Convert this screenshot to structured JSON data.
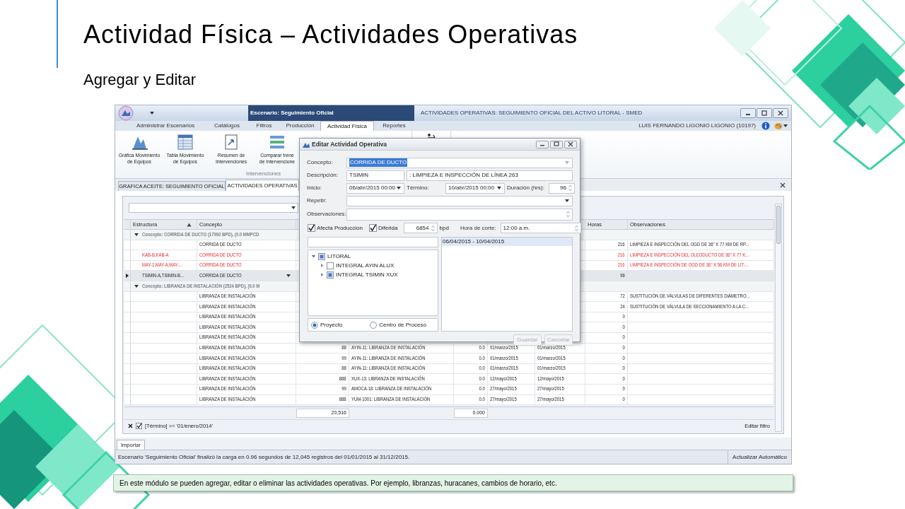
{
  "slide": {
    "title": "Actividad Física – Actividades Operativas",
    "subtitle": "Agregar y Editar",
    "caption": "En este módulo se pueden agregar, editar o eliminar las actividades operativas. Por ejemplo, libranzas, huracanes, cambios de horario, etc."
  },
  "app": {
    "scenario": "Escenario: Seguimiento Oficial",
    "window_title": "ACTIVIDADES OPERATIVAS: SEGUIMIENTO OFICIAL  DEL ACTIVO LITORAL - SMED",
    "ribbon_tabs": [
      {
        "label": "Administrar Escenarios",
        "selected": false
      },
      {
        "label": "Catálogos",
        "selected": false
      },
      {
        "label": "Filtros",
        "selected": false
      },
      {
        "label": "Producción",
        "selected": false
      },
      {
        "label": "Actividad Física",
        "selected": true
      },
      {
        "label": "Reportes",
        "selected": false
      }
    ],
    "user": "LUIS FERNANDO LIGONIO LIGONIO (10197)",
    "ribbon_buttons": [
      {
        "kind": "chart",
        "lines": [
          "Gráfica Movimiento",
          "de Equipos"
        ]
      },
      {
        "kind": "table",
        "lines": [
          "Tabla Movimiento",
          "de Equipos"
        ]
      },
      {
        "kind": "summary",
        "lines": [
          "Resumen de",
          "Intervenciones"
        ]
      },
      {
        "kind": "compare",
        "lines": [
          "Comparar trene",
          "de Intervencione"
        ]
      }
    ],
    "ribbon_group": "Intervenciones",
    "doc_tabs": [
      {
        "label": "GRAFICA ACEITE: SEGUIMIENTO OFICIAL",
        "selected": false
      },
      {
        "label": "ACTIVIDADES OPERATIVAS",
        "selected": true
      }
    ],
    "grid": {
      "columns": [
        {
          "label": "Estructura",
          "sorted": true
        },
        {
          "label": "Concepto",
          "sorted": false
        },
        {
          "label": "Horas",
          "sorted": false
        },
        {
          "label": "Observaciones",
          "sorted": false
        }
      ],
      "rows": [
        {
          "kind": "group",
          "expanded": true,
          "text": "Concepto: CORRIDA  DE DUCTO (17992 BPD), (0.0 MMPCD"
        },
        {
          "kind": "data",
          "selected": false,
          "flagged": false,
          "cells": {
            "concepto": "CORRIDA  DE DUCTO",
            "horas": "216",
            "observaciones": "LIMPIEZA E INSPECCIÓN DEL OGD DE 36\" X 77 KM DE RP..."
          }
        },
        {
          "kind": "data",
          "selected": false,
          "flagged": true,
          "cells": {
            "estructura": "KAB-B,KAB-A",
            "concepto": "CORRIDA  DE DUCTO",
            "horas": "216",
            "observaciones": "LIMPIEZA E INSPECCIÓN DEL OLEODUCTO DE 36\" X 77 K..."
          }
        },
        {
          "kind": "data",
          "selected": false,
          "flagged": true,
          "cells": {
            "estructura": "MAY-1,MAY-A,MAY-...",
            "concepto": "CORRIDA  DE DUCTO",
            "horas": "216",
            "observaciones": "LIMPIEZA E INSPECCIÓN DE OGD DE 36\" X 56 KM DE LIT-..."
          }
        },
        {
          "kind": "data",
          "selected": true,
          "flagged": false,
          "cells": {
            "estructura": "TSIMIN-A,TSIMIN-B...",
            "concepto": "CORRIDA  DE DUCTO",
            "horas": "96"
          }
        },
        {
          "kind": "group",
          "expanded": true,
          "text": "Concepto: LIBRANZA DE INSTALACIÓN (2524 BPD), (0.0 M"
        },
        {
          "kind": "data",
          "selected": false,
          "flagged": false,
          "cells": {
            "concepto": "LIBRANZA DE INSTALACIÓN",
            "horas": "72",
            "observaciones": "SUSTITUCIÓN DE VÁLVULAS DE DIFERENTES DIÁMETRO..."
          }
        },
        {
          "kind": "data",
          "selected": false,
          "flagged": false,
          "cells": {
            "concepto": "LIBRANZA DE INSTALACIÓN",
            "horas": "24",
            "observaciones": "SUSTITUCIÓN DE VÁLVULA DE SECCIONAMIENTO A LA C..."
          }
        },
        {
          "kind": "data",
          "selected": false,
          "flagged": false,
          "cells": {
            "concepto": "LIBRANZA DE INSTALACIÓN",
            "horas": "0"
          }
        },
        {
          "kind": "data",
          "selected": false,
          "flagged": false,
          "cells": {
            "concepto": "LIBRANZA DE INSTALACIÓN",
            "horas": "0"
          }
        },
        {
          "kind": "data",
          "selected": false,
          "flagged": false,
          "cells": {
            "concepto": "LIBRANZA DE INSTALACIÓN",
            "horas": "0"
          }
        },
        {
          "kind": "data",
          "selected": false,
          "flagged": false,
          "cells": {
            "concepto": "LIBRANZA DE INSTALACIÓN",
            "column_3": "88",
            "column_4": "AYIN-11: LIBRANZA DE INSTALACIÓN",
            "column_5": "0.0",
            "column_6": "01/marzo/2015",
            "column_7": "01/marzo/2015",
            "horas": "0"
          }
        },
        {
          "kind": "data",
          "selected": false,
          "flagged": false,
          "cells": {
            "concepto": "LIBRANZA DE INSTALACIÓN",
            "column_3": "99",
            "column_4": "AYIN-11: LIBRANZA DE INSTALACIÓN",
            "column_5": "0.0",
            "column_6": "01/marzo/2015",
            "column_7": "01/marzo/2015",
            "horas": "0"
          }
        },
        {
          "kind": "data",
          "selected": false,
          "flagged": false,
          "cells": {
            "concepto": "LIBRANZA DE INSTALACIÓN",
            "column_3": "88",
            "column_4": "AYIN-11: LIBRANZA DE INSTALACIÓN",
            "column_5": "0.0",
            "column_6": "01/marzo/2015",
            "column_7": "01/marzo/2015",
            "horas": "0"
          }
        },
        {
          "kind": "data",
          "selected": false,
          "flagged": false,
          "cells": {
            "concepto": "LIBRANZA DE INSTALACIÓN",
            "column_3": "888",
            "column_4": "XUX-13: LIBRANZA DE INSTALACIÓN",
            "column_5": "0.0",
            "column_6": "12/mayo/2015",
            "column_7": "12/mayo/2015",
            "horas": "0"
          }
        },
        {
          "kind": "data",
          "selected": false,
          "flagged": false,
          "cells": {
            "concepto": "LIBRANZA DE INSTALACIÓN",
            "column_3": "99",
            "column_4": "AMOCA-18: LIBRANZA DE INSTALACIÓN",
            "column_5": "0.0",
            "column_6": "27/mayo/2015",
            "column_7": "27/mayo/2015",
            "horas": "0"
          }
        },
        {
          "kind": "data",
          "selected": false,
          "flagged": false,
          "cells": {
            "concepto": "LIBRANZA DE INSTALACIÓN",
            "column_3": "888",
            "column_4": "YUM-1001: LIBRANZA DE INSTALACIÓN",
            "column_5": "0.0",
            "column_6": "27/mayo/2015",
            "column_7": "27/mayo/2015",
            "horas": "0"
          }
        }
      ],
      "totals": {
        "column_3": "20,516",
        "column_5": "0.000"
      },
      "filter": {
        "enabled": true,
        "text": "[Término] >= '01/enero/2014'",
        "edit": "Editar filtro"
      }
    },
    "bottom_tab": "Importar",
    "status": "Escenario 'Seguimiento Oficial' finalizó la carga en 0.96 segundos de 12,045 registros del 01/01/2015 al 31/12/2015.",
    "status_right": "Actualizar Automático"
  },
  "dialog": {
    "title": "Editar Actividad Operativa",
    "concepto": {
      "label": "Concepto:",
      "value": "CORRIDA  DE DUCTO"
    },
    "descripcion": {
      "label": "Descripción:",
      "code": "TSIMIN",
      "value": ": LIMPIEZA E INSPECCIÓN DE LÍNEA 263"
    },
    "inicio": {
      "label": "Inicio:",
      "value": "06/abr/2015 00:00"
    },
    "termino": {
      "label": "Término:",
      "value": "10/abr/2015 00:00"
    },
    "duracion": {
      "label": "Duración (hrs):",
      "value": "96"
    },
    "repetir": {
      "label": "Repetir:"
    },
    "observaciones": {
      "label": "Observaciones:"
    },
    "checks": [
      {
        "label": "Afecta Produccion",
        "checked": true
      },
      {
        "label": "Diferida",
        "checked": true
      }
    ],
    "bpd": {
      "value": "6854",
      "unit": "bpd"
    },
    "hora_corte": {
      "label": "Hora de corte:",
      "value": "12:00 a.m."
    },
    "tree": [
      {
        "label": "LITORAL",
        "checked": true,
        "expanded": true,
        "children": [
          {
            "label": "INTEGRAL AYIN ALUX",
            "checked": false,
            "expanded": false
          },
          {
            "label": "INTEGRAL TSIMIN XUX",
            "checked": true,
            "expanded": false
          }
        ]
      }
    ],
    "radios": [
      {
        "label": "Proyecto",
        "selected": true
      },
      {
        "label": "Centro de Proceso",
        "selected": false
      }
    ],
    "periods": [
      {
        "label": "06/04/2015 - 10/04/2015",
        "selected": true
      }
    ],
    "buttons": [
      {
        "label": "Guardar",
        "disabled": true
      },
      {
        "label": "Cancelar",
        "disabled": true
      }
    ]
  }
}
